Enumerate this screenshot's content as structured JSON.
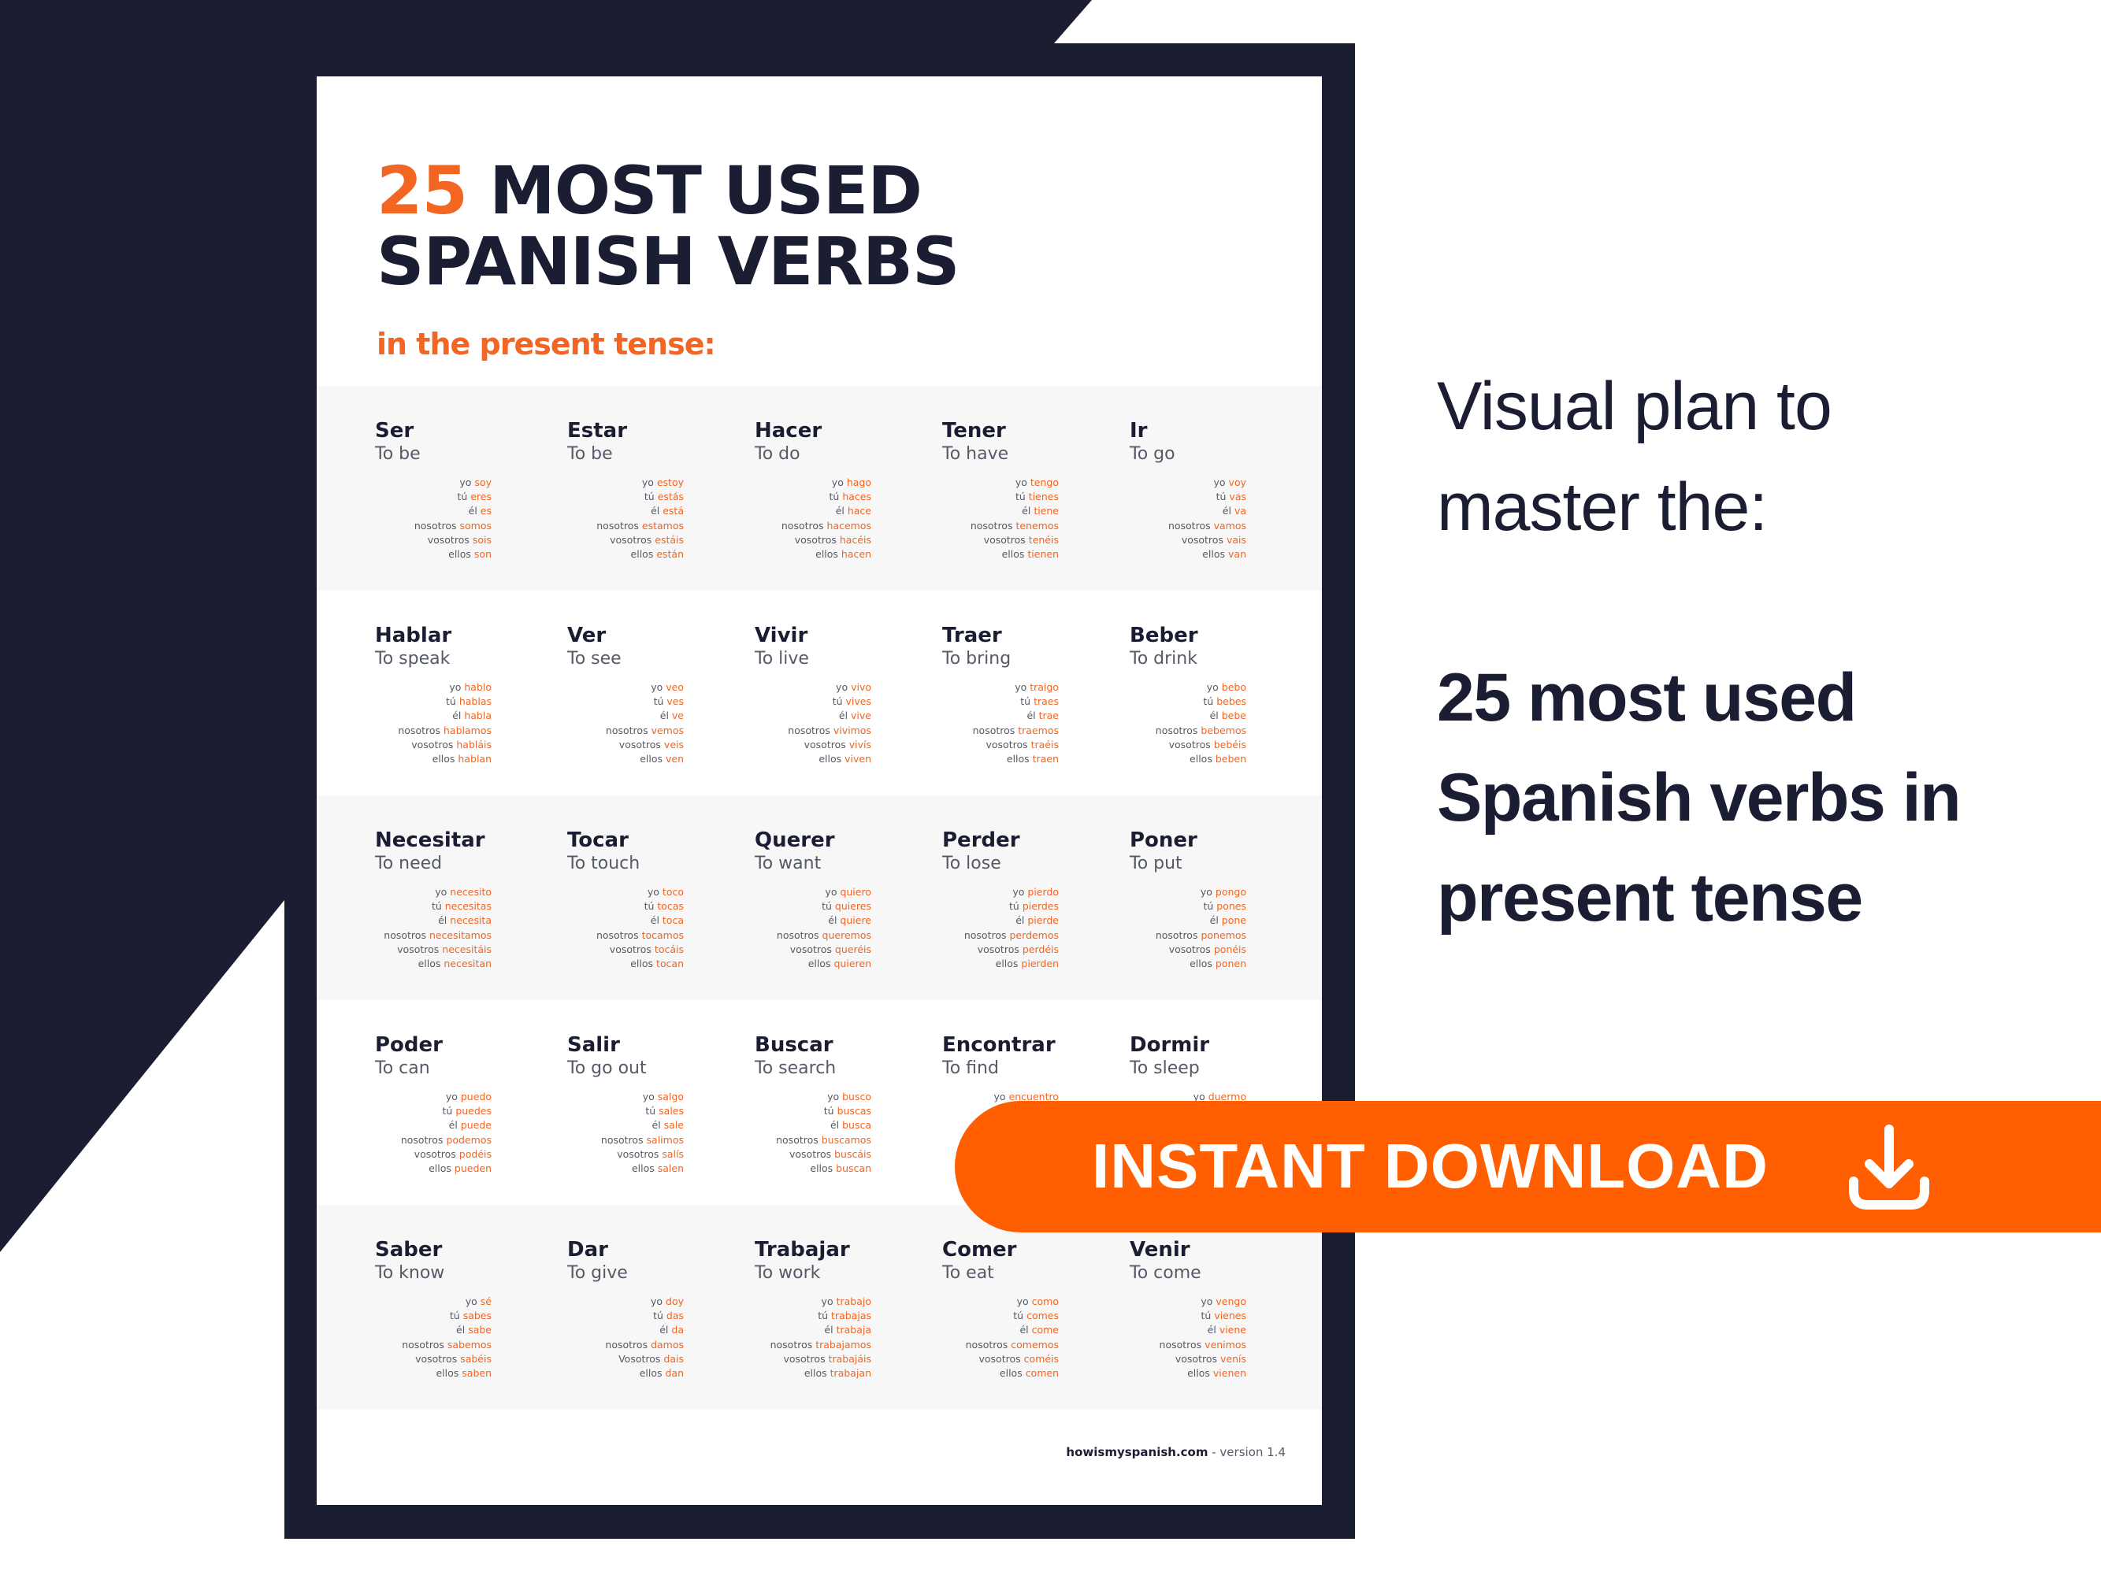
{
  "colors": {
    "navy": "#1b1d33",
    "accent_orange": "#f26522",
    "banner_orange": "#ff5f00"
  },
  "poster": {
    "title_number": "25",
    "title_line1_rest": "MOST USED",
    "title_line2": "SPANISH VERBS",
    "subtitle": "in the present tense:",
    "footer_site": "howismyspanish.com",
    "footer_version": " - version 1.4",
    "pronouns": [
      "yo",
      "tú",
      "él",
      "nosotros",
      "vosotros",
      "ellos"
    ],
    "rows": [
      [
        {
          "verb": "Ser",
          "meaning": "To be",
          "forms": [
            "soy",
            "eres",
            "es",
            "somos",
            "sois",
            "son"
          ]
        },
        {
          "verb": "Estar",
          "meaning": "To be",
          "forms": [
            "estoy",
            "estás",
            "está",
            "estamos",
            "estáis",
            "están"
          ]
        },
        {
          "verb": "Hacer",
          "meaning": "To do",
          "forms": [
            "hago",
            "haces",
            "hace",
            "hacemos",
            "hacéis",
            "hacen"
          ]
        },
        {
          "verb": "Tener",
          "meaning": "To have",
          "forms": [
            "tengo",
            "tienes",
            "tiene",
            "tenemos",
            "tenéis",
            "tienen"
          ]
        },
        {
          "verb": "Ir",
          "meaning": "To go",
          "forms": [
            "voy",
            "vas",
            "va",
            "vamos",
            "vais",
            "van"
          ]
        }
      ],
      [
        {
          "verb": "Hablar",
          "meaning": "To speak",
          "forms": [
            "hablo",
            "hablas",
            "habla",
            "hablamos",
            "habláis",
            "hablan"
          ]
        },
        {
          "verb": "Ver",
          "meaning": "To see",
          "forms": [
            "veo",
            "ves",
            "ve",
            "vemos",
            "veis",
            "ven"
          ]
        },
        {
          "verb": "Vivir",
          "meaning": "To live",
          "forms": [
            "vivo",
            "vives",
            "vive",
            "vivimos",
            "vivís",
            "viven"
          ]
        },
        {
          "verb": "Traer",
          "meaning": "To bring",
          "forms": [
            "traigo",
            "traes",
            "trae",
            "traemos",
            "traéis",
            "traen"
          ]
        },
        {
          "verb": "Beber",
          "meaning": "To drink",
          "forms": [
            "bebo",
            "bebes",
            "bebe",
            "bebemos",
            "bebéis",
            "beben"
          ]
        }
      ],
      [
        {
          "verb": "Necesitar",
          "meaning": "To need",
          "forms": [
            "necesito",
            "necesitas",
            "necesita",
            "necesitamos",
            "necesitáis",
            "necesitan"
          ]
        },
        {
          "verb": "Tocar",
          "meaning": "To touch",
          "forms": [
            "toco",
            "tocas",
            "toca",
            "tocamos",
            "tocáis",
            "tocan"
          ]
        },
        {
          "verb": "Querer",
          "meaning": "To want",
          "forms": [
            "quiero",
            "quieres",
            "quiere",
            "queremos",
            "queréis",
            "quieren"
          ]
        },
        {
          "verb": "Perder",
          "meaning": "To lose",
          "forms": [
            "pierdo",
            "pierdes",
            "pierde",
            "perdemos",
            "perdéis",
            "pierden"
          ]
        },
        {
          "verb": "Poner",
          "meaning": "To put",
          "forms": [
            "pongo",
            "pones",
            "pone",
            "ponemos",
            "ponéis",
            "ponen"
          ]
        }
      ],
      [
        {
          "verb": "Poder",
          "meaning": "To can",
          "forms": [
            "puedo",
            "puedes",
            "puede",
            "podemos",
            "podéis",
            "pueden"
          ]
        },
        {
          "verb": "Salir",
          "meaning": "To go out",
          "forms": [
            "salgo",
            "sales",
            "sale",
            "salimos",
            "salís",
            "salen"
          ]
        },
        {
          "verb": "Buscar",
          "meaning": "To search",
          "forms": [
            "busco",
            "buscas",
            "busca",
            "buscamos",
            "buscáis",
            "buscan"
          ]
        },
        {
          "verb": "Encontrar",
          "meaning": "To find",
          "forms": [
            "encuentro"
          ]
        },
        {
          "verb": "Dormir",
          "meaning": "To sleep",
          "forms": [
            "duermo"
          ]
        }
      ],
      [
        {
          "verb": "Saber",
          "meaning": "To know",
          "forms": [
            "sé",
            "sabes",
            "sabe",
            "sabemos",
            "sabéis",
            "saben"
          ]
        },
        {
          "verb": "Dar",
          "meaning": "To give",
          "forms": [
            "doy",
            "das",
            "da",
            "damos",
            "dais",
            "dan"
          ],
          "pronoun_override": {
            "4": "Vosotros"
          }
        },
        {
          "verb": "Trabajar",
          "meaning": "To work",
          "forms": [
            "trabajo",
            "trabajas",
            "trabaja",
            "trabajamos",
            "trabajáis",
            "trabajan"
          ]
        },
        {
          "verb": "Comer",
          "meaning": "To eat",
          "forms": [
            "como",
            "comes",
            "come",
            "comemos",
            "coméis",
            "comen"
          ]
        },
        {
          "verb": "Venir",
          "meaning": "To come",
          "forms": [
            "vengo",
            "vienes",
            "viene",
            "venimos",
            "venís",
            "vienen"
          ]
        }
      ]
    ]
  },
  "promo": {
    "intro_line1": "Visual plan to",
    "intro_line2": "master the:",
    "headline_line1": "25 most used",
    "headline_line2": "Spanish verbs in",
    "headline_line3": "present tense",
    "cta_label": "INSTANT DOWNLOAD",
    "cta_icon": "download-icon"
  }
}
